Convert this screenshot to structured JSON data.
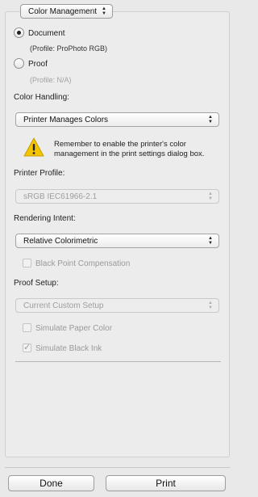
{
  "section_popup": {
    "label": "Color Management"
  },
  "document_option": {
    "label": "Document",
    "profile": "(Profile: ProPhoto RGB)",
    "selected": true
  },
  "proof_option": {
    "label": "Proof",
    "profile": "(Profile: N/A)",
    "selected": false
  },
  "color_handling": {
    "label": "Color Handling:",
    "value": "Printer Manages Colors",
    "warning": "Remember to enable the printer's color management in the print settings dialog box."
  },
  "printer_profile": {
    "label": "Printer Profile:",
    "value": "sRGB IEC61966-2.1",
    "enabled": false
  },
  "rendering_intent": {
    "label": "Rendering Intent:",
    "value": "Relative Colorimetric"
  },
  "black_point": {
    "label": "Black Point Compensation",
    "checked": false,
    "enabled": false
  },
  "proof_setup": {
    "label": "Proof Setup:",
    "value": "Current Custom Setup",
    "enabled": false,
    "simulate_paper": {
      "label": "Simulate Paper Color",
      "checked": false
    },
    "simulate_black": {
      "label": "Simulate Black Ink",
      "checked": true
    }
  },
  "buttons": {
    "done": "Done",
    "print": "Print"
  },
  "icons": {
    "arrows": "up-down-arrows-icon",
    "warning": "warning-triangle-icon",
    "check": "check-icon"
  },
  "colors": {
    "warning_fill": "#f5c400",
    "background": "#e9e9e9"
  }
}
